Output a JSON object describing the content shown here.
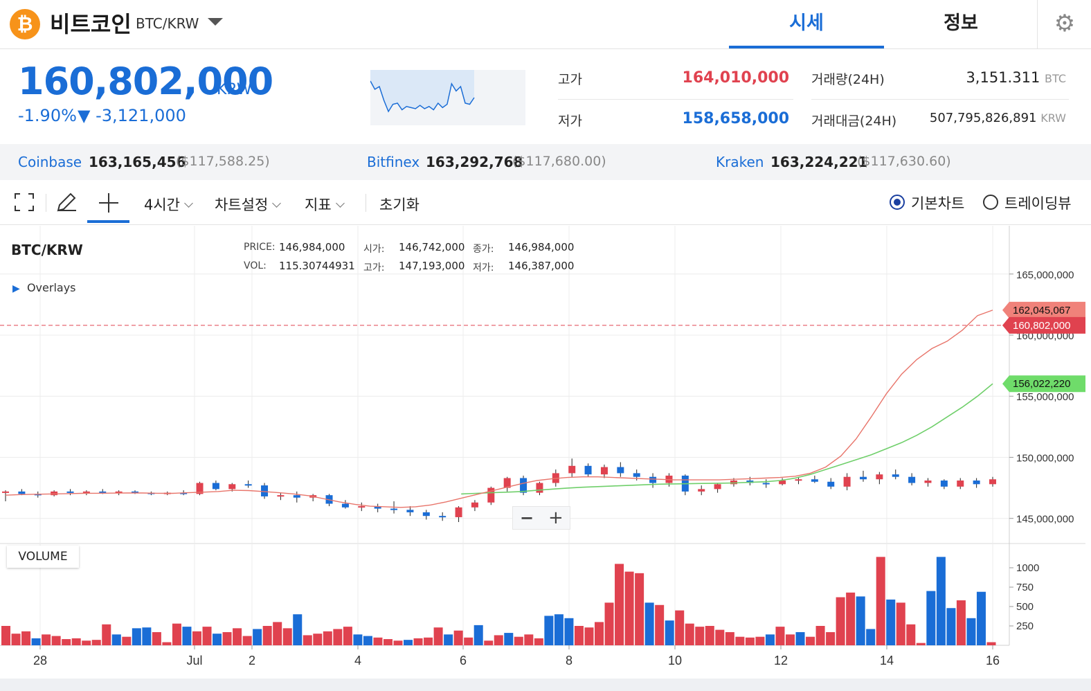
{
  "header": {
    "logo_glyph": "₿",
    "coin_name": "비트코인",
    "pair": "BTC/KRW",
    "tabs": [
      {
        "label": "시세"
      },
      {
        "label": "정보"
      }
    ],
    "settings_icon": "gear-icon"
  },
  "summary": {
    "price": "160,802,000",
    "unit": "KRW",
    "change_pct": "-1.90%",
    "change_abs": "▼ -3,121,000",
    "high_label": "고가",
    "high_value": "164,010,000",
    "low_label": "저가",
    "low_value": "158,658,000",
    "volume_label": "거래량(24H)",
    "volume_value": "3,151.311",
    "volume_unit": "BTC",
    "turnover_label": "거래대금(24H)",
    "turnover_value": "507,795,826,891",
    "turnover_unit": "KRW",
    "sparkline": [
      0.2,
      0.35,
      0.3,
      0.55,
      0.75,
      0.62,
      0.6,
      0.72,
      0.66,
      0.68,
      0.7,
      0.64,
      0.7,
      0.66,
      0.72,
      0.6,
      0.68,
      0.62,
      0.25,
      0.38,
      0.3,
      0.6,
      0.62,
      0.5
    ]
  },
  "exchanges": [
    {
      "name": "Coinbase",
      "price": "163,165,456",
      "usd": "($117,588.25)"
    },
    {
      "name": "Bitfinex",
      "price": "163,292,768",
      "usd": "($117,680.00)"
    },
    {
      "name": "Kraken",
      "price": "163,224,221",
      "usd": "($117,630.60)"
    }
  ],
  "toolbar": {
    "interval": "4시간",
    "chart_settings": "차트설정",
    "indicators": "지표",
    "reset": "초기화",
    "radio_basic": "기본차트",
    "radio_tradingview": "트레이딩뷰"
  },
  "chart_info": {
    "symbol": "BTC/KRW",
    "overlays": "Overlays",
    "price_label": "PRICE:",
    "price_value": "146,984,000",
    "open_label": "시가:",
    "open_value": "146,742,000",
    "close_label": "종가:",
    "close_value": "146,984,000",
    "vol_label": "VOL:",
    "vol_value": "115.30744931",
    "high_label": "고가:",
    "high_value": "147,193,000",
    "low_label": "저가:",
    "low_value": "146,387,000",
    "volume_title": "VOLUME",
    "zoom_out": "−",
    "zoom_in": "+",
    "colors": {
      "up": "#e0424f",
      "down": "#1a6dd6",
      "ma_short": "#e8746a",
      "ma_long": "#6fcf6a"
    }
  },
  "chart_data": {
    "type": "candlestick",
    "title": "BTC/KRW",
    "ylim": [
      143000000,
      168500000
    ],
    "y_ticks": [
      145000000,
      150000000,
      155000000,
      160000000,
      165000000
    ],
    "y_tick_labels": [
      "145,000,000",
      "150,000,000",
      "155,000,000",
      "160,000,000",
      "165,000,000"
    ],
    "x_tick_labels": [
      "28",
      "Jul",
      "2",
      "4",
      "6",
      "8",
      "10",
      "12",
      "14",
      "16"
    ],
    "x_tick_index": [
      4,
      22,
      24,
      30,
      36,
      42,
      48,
      54,
      60,
      66
    ],
    "current_price": 160802000,
    "current_price_label": "160,802,000",
    "ma_short_last_label": "162,045,067",
    "ma_long_last_label": "156,022,220",
    "volume_ticks": [
      250,
      500,
      750,
      1000
    ],
    "candles_open": [
      147050000,
      147050000,
      147000000,
      146950000,
      147000000,
      146950000,
      147000000,
      147100000,
      147000000,
      147050000,
      147050000,
      146950000,
      147000000,
      146950000,
      147000000,
      147650000,
      147050000,
      147050000,
      146950000,
      146900000,
      146850000,
      146850000,
      146250000,
      146100000,
      146250000,
      146150000,
      146050000,
      145700000,
      145650000,
      145800000,
      146050000,
      146100000,
      146650000,
      147050000,
      147700000,
      147650000,
      147550000,
      148000000,
      148350000,
      148550000,
      148350000,
      148150000,
      148000000,
      147950000,
      147750000,
      147950000,
      147650000,
      147250000,
      147300000,
      147500000,
      147600000,
      147500000,
      147650000,
      147500000,
      147700000,
      147800000,
      147600000,
      147650000,
      147650000,
      147650000,
      147600000,
      147750000,
      147850000,
      148050000,
      147800000,
      147500000
    ],
    "candles_close": [
      147050000,
      147000000,
      146950000,
      147000000,
      146950000,
      147000000,
      147100000,
      147000000,
      147050000,
      147050000,
      146950000,
      147000000,
      146950000,
      147000000,
      147650000,
      147050000,
      147050000,
      146950000,
      146900000,
      146850000,
      146850000,
      146250000,
      146100000,
      146250000,
      146150000,
      146050000,
      145700000,
      145650000,
      145800000,
      146050000,
      146100000,
      146650000,
      147050000,
      147700000,
      147650000,
      147550000,
      148000000,
      148350000,
      148550000,
      148350000,
      148150000,
      148000000,
      147950000,
      147750000,
      147950000,
      147650000,
      147250000,
      147300000,
      147500000,
      147600000,
      147500000,
      147650000,
      147500000,
      147700000,
      147800000,
      147600000,
      147650000,
      147650000,
      147650000,
      147600000,
      147750000,
      147850000,
      148050000,
      147800000,
      147500000,
      147650000
    ],
    "series": [
      {
        "name": "BTC/KRW",
        "values": [
          147050000,
          147000000,
          146950000,
          147000000,
          146950000,
          147000000,
          147100000,
          147000000,
          147050000,
          147050000,
          146950000,
          147000000,
          146950000,
          147000000,
          147650000,
          147050000,
          147050000,
          146950000,
          146900000,
          146850000,
          146850000,
          146250000,
          146100000,
          146250000,
          146150000,
          146050000,
          145700000,
          145650000,
          145800000,
          146050000,
          146100000,
          146650000,
          147050000,
          147700000,
          147650000,
          147550000,
          148000000,
          148350000,
          148550000,
          148350000,
          148150000,
          148000000,
          147950000,
          147750000,
          147950000,
          147650000,
          147250000,
          147300000,
          147500000,
          147600000,
          147500000,
          147650000,
          147500000,
          147700000,
          147800000,
          147600000,
          147650000,
          147650000,
          147650000,
          147600000,
          147750000,
          147850000,
          148050000,
          147800000,
          147500000,
          147650000
        ]
      }
    ],
    "candles": [
      [
        147100000,
        147300000,
        146400000,
        147200000
      ],
      [
        147200000,
        147400000,
        146900000,
        147000000
      ],
      [
        147000000,
        147200000,
        146700000,
        146900000
      ],
      [
        146900000,
        147300000,
        146800000,
        147200000
      ],
      [
        147200000,
        147400000,
        146900000,
        147100000
      ],
      [
        147100000,
        147300000,
        146900000,
        147200000
      ],
      [
        147200000,
        147400000,
        147000000,
        147100000
      ],
      [
        147100000,
        147300000,
        146900000,
        147200000
      ],
      [
        147200000,
        147300000,
        147000000,
        147100000
      ],
      [
        147100000,
        147200000,
        146900000,
        147000000
      ],
      [
        147000000,
        147200000,
        146900000,
        147100000
      ],
      [
        147100000,
        147300000,
        146900000,
        147000000
      ],
      [
        147000000,
        148000000,
        146900000,
        147900000
      ],
      [
        147900000,
        148100000,
        147300000,
        147400000
      ],
      [
        147400000,
        147900000,
        147200000,
        147800000
      ],
      [
        147800000,
        148100000,
        147500000,
        147700000
      ],
      [
        147700000,
        147900000,
        146600000,
        146800000
      ],
      [
        146800000,
        147100000,
        146500000,
        146900000
      ],
      [
        146900000,
        147200000,
        146300000,
        146700000
      ],
      [
        146700000,
        147000000,
        146400000,
        146900000
      ],
      [
        146900000,
        147000000,
        146000000,
        146200000
      ],
      [
        146200000,
        146500000,
        145800000,
        145900000
      ],
      [
        145900000,
        146300000,
        145600000,
        146000000
      ],
      [
        146000000,
        146200000,
        145500000,
        145800000
      ],
      [
        145800000,
        146400000,
        145400000,
        145700000
      ],
      [
        145700000,
        146000000,
        145200000,
        145500000
      ],
      [
        145500000,
        145700000,
        144900000,
        145200000
      ],
      [
        145200000,
        145500000,
        144800000,
        145100000
      ],
      [
        145100000,
        146000000,
        144700000,
        145900000
      ],
      [
        145900000,
        146500000,
        145600000,
        146300000
      ],
      [
        146300000,
        147600000,
        146100000,
        147500000
      ],
      [
        147500000,
        148400000,
        147200000,
        148300000
      ],
      [
        148300000,
        148500000,
        146900000,
        147100000
      ],
      [
        147100000,
        148000000,
        146900000,
        147900000
      ],
      [
        147900000,
        149000000,
        147600000,
        148700000
      ],
      [
        148700000,
        149900000,
        148400000,
        149300000
      ],
      [
        149300000,
        149500000,
        148400000,
        148600000
      ],
      [
        148600000,
        149400000,
        148300000,
        149200000
      ],
      [
        149200000,
        149600000,
        148400000,
        148700000
      ],
      [
        148700000,
        149000000,
        148100000,
        148400000
      ],
      [
        148400000,
        148700000,
        147500000,
        147900000
      ],
      [
        147900000,
        148700000,
        147600000,
        148500000
      ],
      [
        148500000,
        148600000,
        146900000,
        147200000
      ],
      [
        147200000,
        147700000,
        146900000,
        147400000
      ],
      [
        147400000,
        147900000,
        147100000,
        147800000
      ],
      [
        147800000,
        148300000,
        147600000,
        148100000
      ],
      [
        148100000,
        148400000,
        147700000,
        147900000
      ],
      [
        147900000,
        148200000,
        147500000,
        147800000
      ],
      [
        147800000,
        148300000,
        147700000,
        148100000
      ],
      [
        148100000,
        148400000,
        147800000,
        148200000
      ],
      [
        148200000,
        148500000,
        147900000,
        148000000
      ],
      [
        148000000,
        148300000,
        147400000,
        147600000
      ],
      [
        147600000,
        148700000,
        147300000,
        148400000
      ],
      [
        148400000,
        148900000,
        148000000,
        148200000
      ],
      [
        148200000,
        148800000,
        147800000,
        148600000
      ],
      [
        148600000,
        149000000,
        148200000,
        148400000
      ],
      [
        148400000,
        148700000,
        147700000,
        147900000
      ],
      [
        147900000,
        148300000,
        147600000,
        148100000
      ],
      [
        148100000,
        148200000,
        147400000,
        147600000
      ],
      [
        147600000,
        148300000,
        147400000,
        148100000
      ],
      [
        148100000,
        148300000,
        147500000,
        147800000
      ],
      [
        147800000,
        148400000,
        147600000,
        148200000
      ]
    ],
    "ma_short": [
      146900000,
      146950000,
      146980000,
      147000000,
      147020000,
      147050000,
      147060000,
      147070000,
      147080000,
      147080000,
      147060000,
      147050000,
      147100000,
      147150000,
      147200000,
      147300000,
      147280000,
      147200000,
      147100000,
      147000000,
      146850000,
      146600000,
      146350000,
      146150000,
      146000000,
      145950000,
      145900000,
      145950000,
      146100000,
      146350000,
      146650000,
      146950000,
      147250000,
      147550000,
      147850000,
      148100000,
      148250000,
      148350000,
      148400000,
      148400000,
      148350000,
      148300000,
      148250000,
      148200000,
      148150000,
      148150000,
      148150000,
      148150000,
      148200000,
      148250000,
      148300000,
      148350000,
      148450000,
      148700000,
      149200000,
      150100000,
      151500000,
      153300000,
      155200000,
      156800000,
      158000000,
      158900000,
      159500000,
      160400000,
      161600000,
      162045067
    ],
    "ma_long": [
      null,
      null,
      null,
      null,
      null,
      null,
      null,
      null,
      null,
      null,
      null,
      null,
      null,
      null,
      null,
      null,
      null,
      null,
      null,
      null,
      null,
      null,
      null,
      null,
      null,
      null,
      null,
      null,
      null,
      null,
      147000000,
      147050000,
      147100000,
      147150000,
      147200000,
      147300000,
      147400000,
      147480000,
      147550000,
      147600000,
      147650000,
      147700000,
      147750000,
      147800000,
      147820000,
      147840000,
      147860000,
      147880000,
      147900000,
      147950000,
      148000000,
      148100000,
      148300000,
      148600000,
      149000000,
      149400000,
      149800000,
      150200000,
      150700000,
      151200000,
      151800000,
      152500000,
      153300000,
      154100000,
      155000000,
      156022220
    ],
    "volume": [
      250,
      150,
      180,
      90,
      140,
      120,
      80,
      90,
      60,
      70,
      270,
      140,
      110,
      220,
      230,
      170,
      40,
      280,
      240,
      180,
      240,
      150,
      170,
      220,
      120,
      210,
      250,
      300,
      220,
      400,
      130,
      150,
      180,
      210,
      240,
      140,
      120,
      100,
      80,
      60,
      70,
      90,
      100,
      230,
      140,
      190,
      100,
      260,
      60,
      130,
      160,
      110,
      140,
      90,
      380,
      400,
      350,
      250,
      230,
      300,
      550,
      1050,
      950,
      930,
      550,
      520,
      320,
      450,
      280,
      240,
      250,
      200,
      170,
      110,
      100,
      110,
      140,
      240,
      140,
      170,
      110,
      250,
      170,
      620,
      680,
      630,
      210,
      1140,
      590,
      550,
      270,
      30,
      700,
      1140,
      480,
      580,
      350,
      690,
      40
    ],
    "volume_up": [
      true,
      true,
      true,
      false,
      true,
      true,
      true,
      true,
      true,
      true,
      true,
      false,
      true,
      false,
      false,
      true,
      true,
      true,
      false,
      true,
      true,
      false,
      true,
      true,
      true,
      false,
      true,
      true,
      true,
      false,
      true,
      true,
      true,
      true,
      true,
      false,
      false,
      true,
      true,
      true,
      false,
      true,
      true,
      true,
      false,
      true,
      true,
      false,
      true,
      true,
      false,
      true,
      true,
      true,
      false,
      false,
      false,
      true,
      true,
      true,
      true,
      true,
      true,
      true,
      false,
      true,
      false,
      true,
      true,
      true,
      true,
      true,
      true,
      true,
      true,
      true,
      false,
      true,
      true,
      false,
      true,
      true,
      true,
      true,
      true,
      false,
      false,
      true,
      false,
      true,
      true,
      true,
      false,
      false,
      false,
      true,
      false,
      false,
      true
    ]
  }
}
